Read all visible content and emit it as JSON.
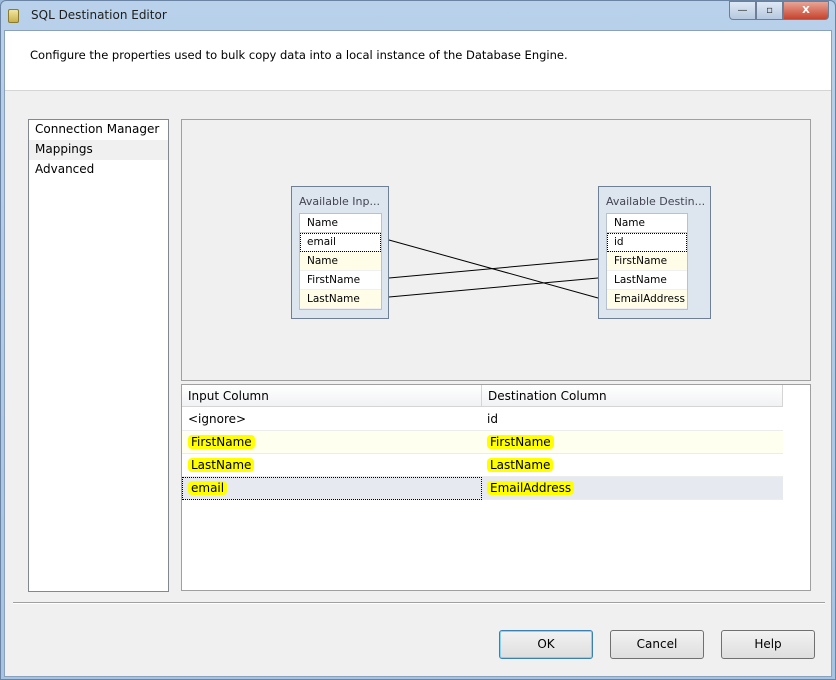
{
  "window": {
    "title": "SQL Destination Editor",
    "minimize": "—",
    "maximize": "▫",
    "close": "X"
  },
  "description": "Configure the properties used to bulk copy data into a local instance of the Database Engine.",
  "nav": {
    "items": [
      {
        "label": "Connection Manager"
      },
      {
        "label": "Mappings"
      },
      {
        "label": "Advanced"
      }
    ]
  },
  "diagram": {
    "input": {
      "title": "Available Inp...",
      "header": "Name",
      "rows": [
        "email",
        "Name",
        "FirstName",
        "LastName"
      ]
    },
    "dest": {
      "title": "Available Destin...",
      "header": "Name",
      "rows": [
        "id",
        "FirstName",
        "LastName",
        "EmailAddress"
      ]
    },
    "links": [
      {
        "from": "email",
        "to": "EmailAddress"
      },
      {
        "from": "FirstName",
        "to": "FirstName"
      },
      {
        "from": "LastName",
        "to": "LastName"
      }
    ]
  },
  "table": {
    "headers": [
      "Input Column",
      "Destination Column"
    ],
    "rows": [
      [
        "<ignore>",
        "id"
      ],
      [
        "FirstName",
        "FirstName"
      ],
      [
        "LastName",
        "LastName"
      ],
      [
        "email",
        "EmailAddress"
      ]
    ]
  },
  "buttons": {
    "ok": "OK",
    "cancel": "Cancel",
    "help": "Help"
  }
}
